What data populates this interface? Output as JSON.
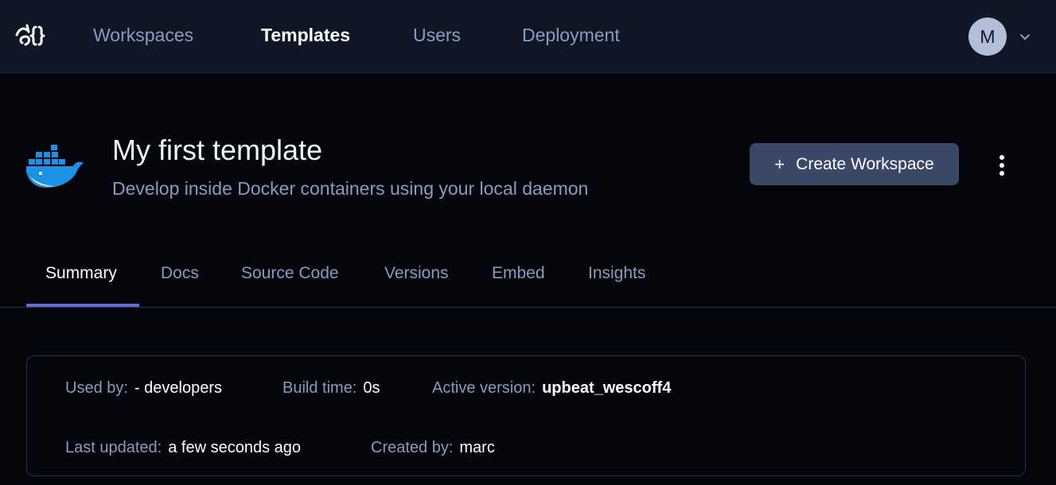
{
  "nav": {
    "items": [
      {
        "label": "Workspaces",
        "active": false
      },
      {
        "label": "Templates",
        "active": true
      },
      {
        "label": "Users",
        "active": false
      },
      {
        "label": "Deployment",
        "active": false
      }
    ],
    "avatar_initial": "M",
    "accent_color": "#5b6fd6"
  },
  "template": {
    "icon": "docker-whale-icon",
    "title": "My first template",
    "description": "Develop inside Docker containers using your local daemon",
    "create_button_label": "Create Workspace"
  },
  "tabs": [
    {
      "label": "Summary",
      "active": true
    },
    {
      "label": "Docs",
      "active": false
    },
    {
      "label": "Source Code",
      "active": false
    },
    {
      "label": "Versions",
      "active": false
    },
    {
      "label": "Embed",
      "active": false
    },
    {
      "label": "Insights",
      "active": false
    }
  ],
  "summary": {
    "used_by": {
      "label": "Used by:",
      "value": "- developers"
    },
    "build_time": {
      "label": "Build time:",
      "value": "0s"
    },
    "active_version": {
      "label": "Active version:",
      "value": "upbeat_wescoff4"
    },
    "last_updated": {
      "label": "Last updated:",
      "value": "a few seconds ago"
    },
    "created_by": {
      "label": "Created by:",
      "value": "marc"
    }
  }
}
